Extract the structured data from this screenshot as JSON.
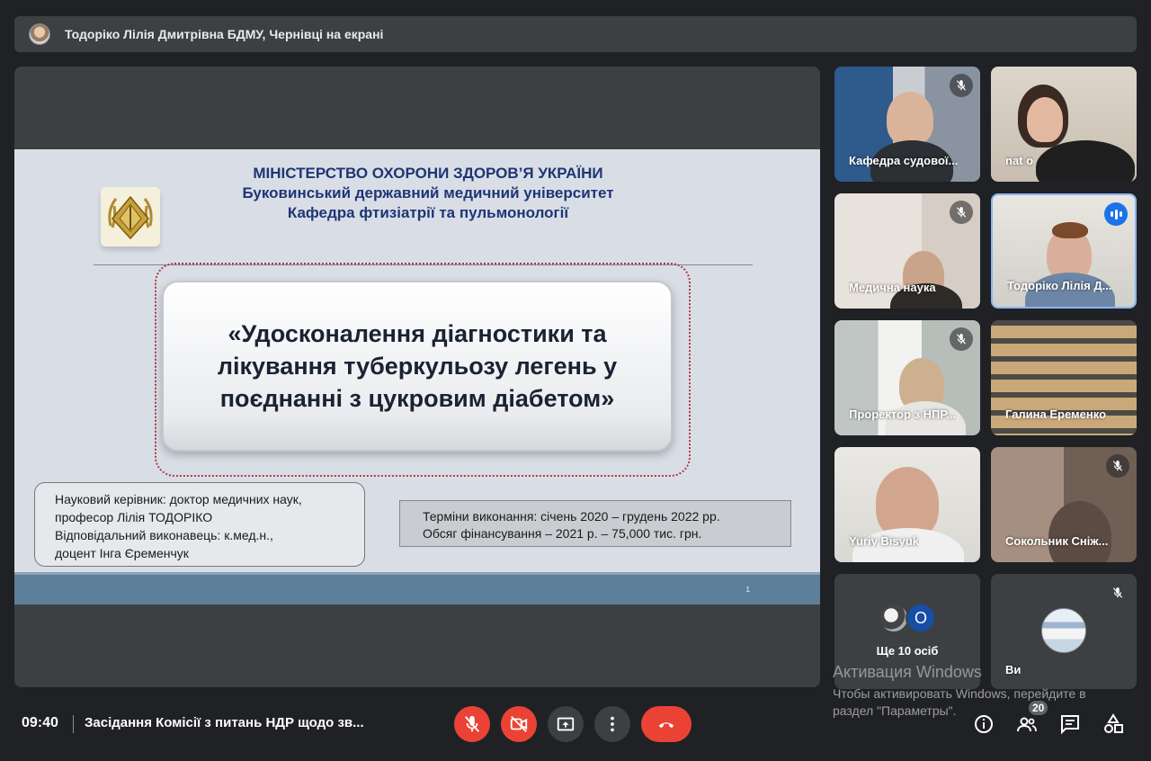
{
  "banner": {
    "presenter_text": "Тодоріко Лілія Дмитрівна БДМУ, Чернівці на екрані"
  },
  "slide": {
    "header_line1": "МІНІСТЕРСТВО ОХОРОНИ ЗДОРОВ’Я УКРАЇНИ",
    "header_line2": "Буковинський державний медичний університет",
    "header_line3": "Кафедра фтизіатрії та пульмонології",
    "title": "«Удосконалення діагностики та лікування туберкульозу легень у поєднанні з цукровим діабетом»",
    "left_info": [
      "Науковий керівник: доктор медичних наук,",
      "професор Лілія ТОДОРІКО",
      "Відповідальний виконавець: к.мед.н.,",
      "доцент Інга Єременчук"
    ],
    "right_info": [
      "Терміни виконання: січень 2020 – грудень 2022 рр.",
      "Обсяг фінансування – 2021 р. – 75,000 тис. грн."
    ],
    "page_number": "1"
  },
  "participants": [
    {
      "name": "Кафедра судової...",
      "muted": true
    },
    {
      "name": "nat o",
      "muted": false
    },
    {
      "name": "Медична наука",
      "muted": true
    },
    {
      "name": "Тодоріко Лілія Д...",
      "muted": false,
      "speaking": true
    },
    {
      "name": "Проректор з НПР...",
      "muted": true
    },
    {
      "name": "Галина Еременко",
      "muted": false
    },
    {
      "name": "Yuriy Bisyuk",
      "muted": false
    },
    {
      "name": "Сокольник Сніж...",
      "muted": true
    }
  ],
  "others": {
    "initial": "О",
    "label": "Ще 10 осіб"
  },
  "self_tile": {
    "name": "Ви",
    "muted": true
  },
  "watermark": {
    "title": "Активация Windows",
    "subtitle": "Чтобы активировать Windows, перейдите в раздел \"Параметры\"."
  },
  "bottom_bar": {
    "time": "09:40",
    "meeting_title": "Засідання Комісії з питань НДР щодо зв...",
    "people_count": "20"
  },
  "colors": {
    "end_call": "#ea4335",
    "control_grey": "#3c4043",
    "speaking": "#1a73e8"
  }
}
